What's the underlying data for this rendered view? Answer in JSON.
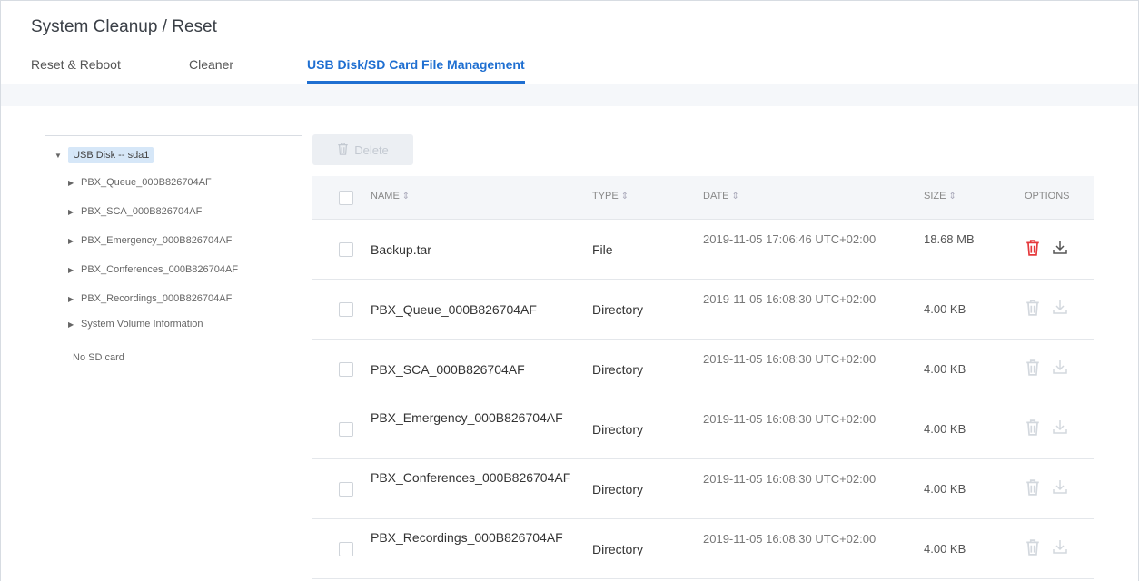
{
  "page": {
    "title": "System Cleanup / Reset"
  },
  "tabs": [
    {
      "label": "Reset & Reboot",
      "active": false
    },
    {
      "label": "Cleaner",
      "active": false
    },
    {
      "label": "USB Disk/SD Card File Management",
      "active": true
    }
  ],
  "tree": {
    "root_label": "USB Disk -- sda1",
    "items": [
      "PBX_Queue_000B826704AF",
      "PBX_SCA_000B826704AF",
      "PBX_Emergency_000B826704AF",
      "PBX_Conferences_000B826704AF",
      "PBX_Recordings_000B826704AF",
      "System Volume Information"
    ],
    "no_sd_label": "No SD card"
  },
  "toolbar": {
    "delete_label": "Delete"
  },
  "table": {
    "headers": {
      "name": "NAME",
      "type": "TYPE",
      "date": "DATE",
      "size": "SIZE",
      "options": "OPTIONS"
    },
    "rows": [
      {
        "name": "Backup.tar",
        "type": "File",
        "date": "2019-11-05 17:06:46 UTC+02:00",
        "size": "18.68 MB",
        "enabled": true
      },
      {
        "name": "PBX_Queue_000B826704AF",
        "type": "Directory",
        "date": "2019-11-05 16:08:30 UTC+02:00",
        "size": "4.00 KB",
        "enabled": false
      },
      {
        "name": "PBX_SCA_000B826704AF",
        "type": "Directory",
        "date": "2019-11-05 16:08:30 UTC+02:00",
        "size": "4.00 KB",
        "enabled": false
      },
      {
        "name": "PBX_Emergency_000B826704AF",
        "type": "Directory",
        "date": "2019-11-05 16:08:30 UTC+02:00",
        "size": "4.00 KB",
        "enabled": false
      },
      {
        "name": "PBX_Conferences_000B826704AF",
        "type": "Directory",
        "date": "2019-11-05 16:08:30 UTC+02:00",
        "size": "4.00 KB",
        "enabled": false
      },
      {
        "name": "PBX_Recordings_000B826704AF",
        "type": "Directory",
        "date": "2019-11-05 16:08:30 UTC+02:00",
        "size": "4.00 KB",
        "enabled": false
      }
    ]
  },
  "colors": {
    "accent": "#1f6fd1",
    "delete_active": "#e5383b",
    "icon_active": "#555555",
    "icon_disabled": "#d3d8de"
  }
}
